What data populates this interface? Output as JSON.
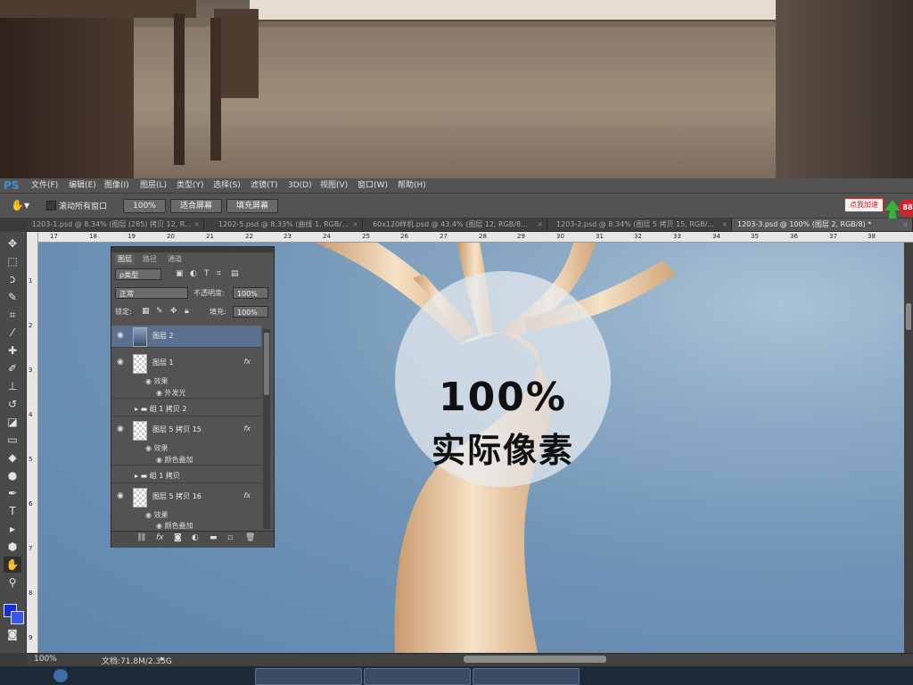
{
  "menu": {
    "logo": "PS",
    "items": [
      "文件(F)",
      "编辑(E)",
      "图像(I)",
      "图层(L)",
      "类型(Y)",
      "选择(S)",
      "滤镜(T)",
      "3D(D)",
      "视图(V)",
      "窗口(W)",
      "帮助(H)"
    ]
  },
  "options": {
    "scroll_all": "滚动所有窗口",
    "zoom_100": "100%",
    "fit_screen": "适合屏幕",
    "fill_screen": "填充屏幕",
    "speed_badge": "点我加速",
    "speed_count": "88"
  },
  "tabs": [
    {
      "label": "1203-1.psd @ 8.34% (图层 (285) 拷贝 12, R...",
      "close": "×"
    },
    {
      "label": "1202-5.psd @ 8.33% (曲线 1, RGB/...",
      "close": "×"
    },
    {
      "label": "60x120样机.psd @ 43.4% (图层 12, RGB/8...",
      "close": "×"
    },
    {
      "label": "1203-2.psd @ 8.34% (图层 5 拷贝 15, RGB/...",
      "close": "×"
    },
    {
      "label": "1203-3.psd @ 100% (图层 2, RGB/8) *",
      "close": "×"
    }
  ],
  "ruler_top": [
    "17",
    "18",
    "19",
    "20",
    "21",
    "22",
    "23",
    "24",
    "25",
    "26",
    "27",
    "28",
    "29",
    "30",
    "31",
    "32",
    "33",
    "34",
    "35",
    "36",
    "37",
    "38"
  ],
  "ruler_left": [
    "1",
    "2",
    "3",
    "4",
    "5",
    "6",
    "7",
    "8",
    "9"
  ],
  "layers_panel": {
    "tabs": [
      "图层",
      "路径",
      "通道"
    ],
    "filter_type": "ρ类型",
    "blend_mode": "正常",
    "opacity_label": "不透明度:",
    "opacity_value": "100%",
    "lock_label": "锁定:",
    "fill_label": "填充:",
    "fill_value": "100%",
    "layers": [
      {
        "name": "图层 2"
      },
      {
        "name": "图层 1",
        "fx": "fx",
        "effects_label": "效果",
        "effect": "外发光"
      },
      {
        "name": "组 1 拷贝 2"
      },
      {
        "name": "图层 5 拷贝 15",
        "fx": "fx",
        "effects_label": "效果",
        "effect": "颜色叠加"
      },
      {
        "name": "组 1 拷贝"
      },
      {
        "name": "图层 5 拷贝 16",
        "fx": "fx",
        "effects_label": "效果",
        "effect": "颜色叠加"
      }
    ]
  },
  "canvas_badge": {
    "percent": "100%",
    "text": "实际像素"
  },
  "status": {
    "zoom": "100%",
    "doc": "文档:71.8M/2.35G"
  },
  "colors": {
    "foreground": "#1530d8",
    "background": "#3a58f0",
    "accent": "#3b8fd9"
  }
}
